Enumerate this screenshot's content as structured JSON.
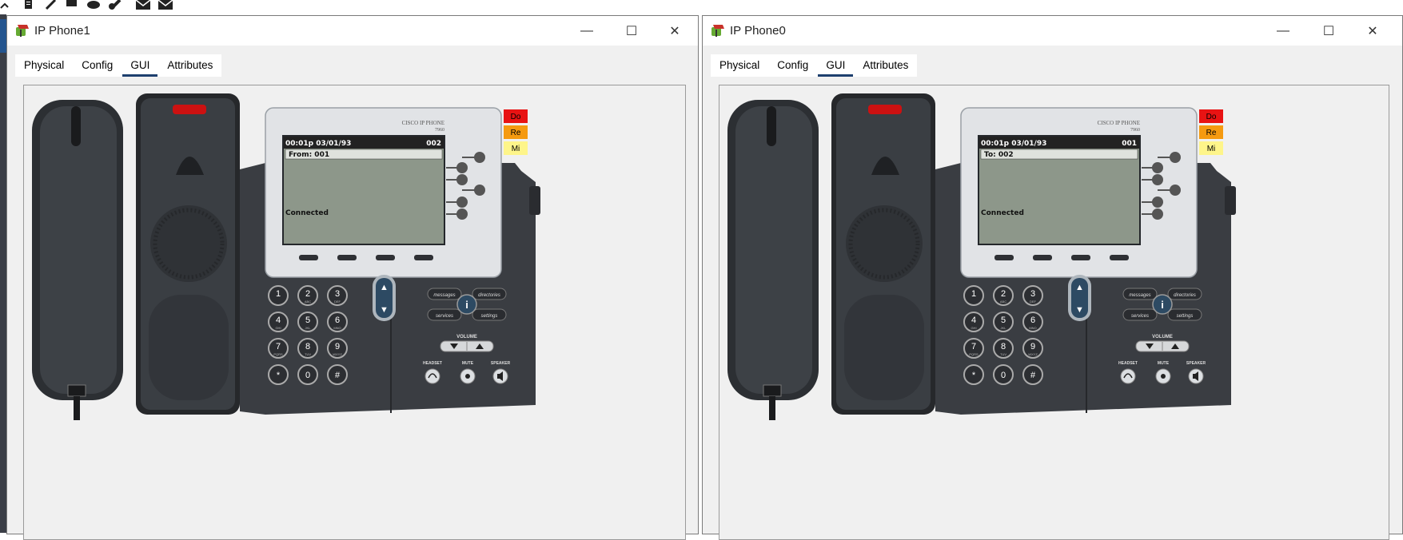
{
  "toolbar_icons": [
    "connection-icon",
    "document-icon",
    "pencil-icon",
    "block-icon",
    "phone-icon",
    "guitar-icon",
    "mail-icon",
    "envelope-icon"
  ],
  "windows": [
    {
      "title": "IP Phone1",
      "tabs": [
        "Physical",
        "Config",
        "GUI",
        "Attributes"
      ],
      "active_tab": "GUI",
      "phone": {
        "brand_line1": "CISCO IP PHONE",
        "brand_line2": "7960",
        "time_date": "00:01p 03/01/93",
        "extension": "002",
        "party": "From: 001",
        "status": "Connected",
        "labels": [
          "Do",
          "Re",
          "Mi"
        ]
      }
    },
    {
      "title": "IP Phone0",
      "tabs": [
        "Physical",
        "Config",
        "GUI",
        "Attributes"
      ],
      "active_tab": "GUI",
      "phone": {
        "brand_line1": "CISCO IP PHONE",
        "brand_line2": "7960",
        "time_date": "00:01p 03/01/93",
        "extension": "001",
        "party": "To: 002",
        "status": "Connected",
        "labels": [
          "Do",
          "Re",
          "Mi"
        ]
      }
    }
  ],
  "keypad": [
    {
      "digit": "1",
      "letters": ""
    },
    {
      "digit": "2",
      "letters": "ABC"
    },
    {
      "digit": "3",
      "letters": "DEF"
    },
    {
      "digit": "4",
      "letters": "GHI"
    },
    {
      "digit": "5",
      "letters": "JKL"
    },
    {
      "digit": "6",
      "letters": "MNO"
    },
    {
      "digit": "7",
      "letters": "PQRS"
    },
    {
      "digit": "8",
      "letters": "TUV"
    },
    {
      "digit": "9",
      "letters": "WXYZ"
    },
    {
      "digit": "*",
      "letters": ""
    },
    {
      "digit": "0",
      "letters": ""
    },
    {
      "digit": "#",
      "letters": ""
    }
  ],
  "function_keys": {
    "messages": "messages",
    "directories": "directories",
    "services": "services",
    "settings": "settings",
    "info": "i"
  },
  "volume_label": "VOLUME",
  "bottom_keys": [
    "HEADSET",
    "MUTE",
    "SPEAKER"
  ],
  "window_controls": {
    "minimize": "—",
    "maximize": "☐",
    "close": "✕"
  }
}
